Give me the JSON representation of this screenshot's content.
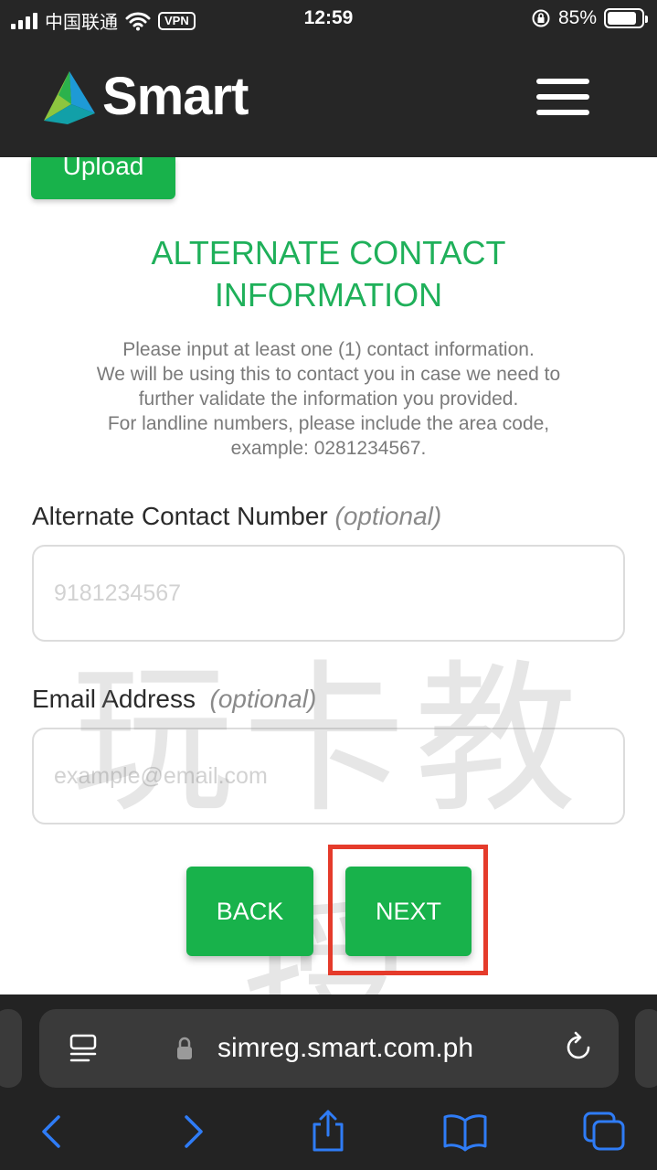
{
  "status_bar": {
    "carrier": "中国联通",
    "vpn": "VPN",
    "time": "12:59",
    "battery": "85%",
    "battery_level": 0.85
  },
  "header": {
    "brand": "Smart"
  },
  "upload": {
    "label": "Upload"
  },
  "alternate_contact": {
    "title_line1": "ALTERNATE CONTACT",
    "title_line2": "INFORMATION",
    "desc_line1": "Please input at least one (1) contact information.",
    "desc_line2": "We will be using this to contact you in case we need to",
    "desc_line3": "further validate the information you provided.",
    "desc_line4": "For landline numbers, please include the area code,",
    "desc_line5": "example: 0281234567."
  },
  "phone_field": {
    "label": "Alternate Contact Number",
    "optional": "(optional)",
    "placeholder": "9181234567",
    "value": ""
  },
  "email_field": {
    "label": "Email Address",
    "optional": "(optional)",
    "placeholder": "example@email.com",
    "value": ""
  },
  "buttons": {
    "back": "BACK",
    "next": "NEXT"
  },
  "watermark": "玩卡教授",
  "browser": {
    "url": "simreg.smart.com.ph"
  }
}
